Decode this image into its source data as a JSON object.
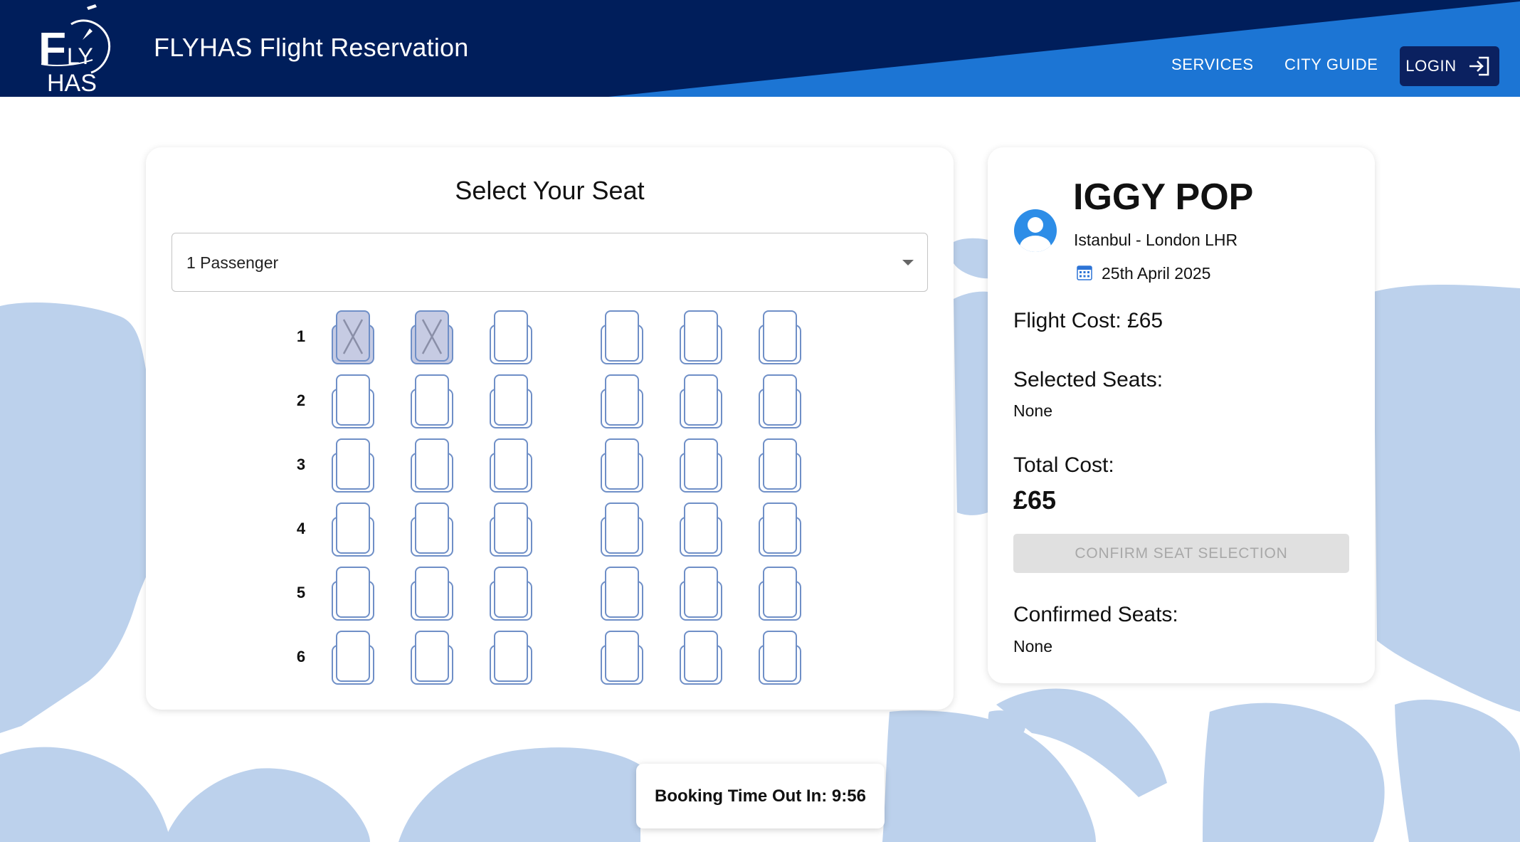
{
  "header": {
    "logo_text": "FLY HAS",
    "title": "FLYHAS Flight Reservation",
    "nav": [
      {
        "label": "SERVICES"
      },
      {
        "label": "CITY GUIDE"
      }
    ],
    "login_label": "LOGIN",
    "colors": {
      "navy": "#001e5b",
      "blue": "#1e74d4",
      "login_bg": "#0b2160"
    }
  },
  "seat_selection": {
    "title": "Select Your Seat",
    "passenger_select": {
      "value": "1 Passenger"
    },
    "rows": [
      {
        "label": "1",
        "seats": [
          "occupied",
          "occupied",
          "available",
          "available",
          "available",
          "available"
        ]
      },
      {
        "label": "2",
        "seats": [
          "available",
          "available",
          "available",
          "available",
          "available",
          "available"
        ]
      },
      {
        "label": "3",
        "seats": [
          "available",
          "available",
          "available",
          "available",
          "available",
          "available"
        ]
      },
      {
        "label": "4",
        "seats": [
          "available",
          "available",
          "available",
          "available",
          "available",
          "available"
        ]
      },
      {
        "label": "5",
        "seats": [
          "available",
          "available",
          "available",
          "available",
          "available",
          "available"
        ]
      },
      {
        "label": "6",
        "seats": [
          "available",
          "available",
          "available",
          "available",
          "available",
          "available"
        ]
      }
    ],
    "colors": {
      "seat_outline": "#6f8fc7",
      "occupied_fill": "#c6cbe3",
      "occupied_mark": "#8a8fa8"
    }
  },
  "passenger_info": {
    "name": "IGGY POP",
    "route": "Istanbul - London LHR",
    "date": "25th April 2025",
    "flight_cost": "Flight Cost: £65",
    "selected_seats_label": "Selected Seats:",
    "selected_seats_value": "None",
    "total_cost_label": "Total Cost:",
    "total_cost_value": "£65",
    "confirm_button": "CONFIRM SEAT SELECTION",
    "confirmed_seats_label": "Confirmed Seats:",
    "confirmed_seats_value": "None",
    "icons": {
      "avatar": "user-avatar-icon",
      "calendar": "calendar-icon"
    }
  },
  "timer": {
    "text": "Booking Time Out In: 9:56"
  },
  "background": {
    "map_color": "#bcd1ec"
  }
}
